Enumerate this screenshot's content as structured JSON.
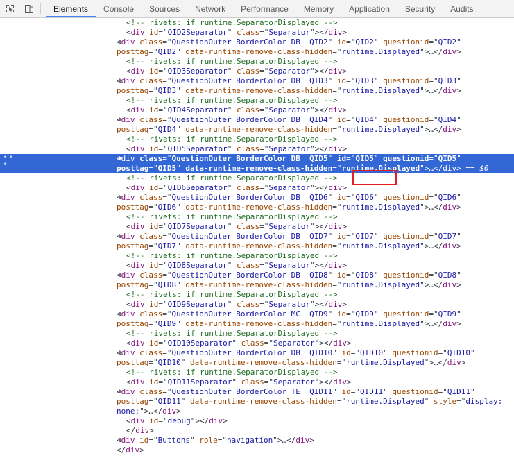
{
  "toolbar": {
    "icons": [
      {
        "name": "inspect-element-icon",
        "title": "Inspect element"
      },
      {
        "name": "device-toolbar-icon",
        "title": "Toggle device toolbar"
      }
    ],
    "tabs": [
      {
        "label": "Elements",
        "selected": true
      },
      {
        "label": "Console",
        "selected": false
      },
      {
        "label": "Sources",
        "selected": false
      },
      {
        "label": "Network",
        "selected": false
      },
      {
        "label": "Performance",
        "selected": false
      },
      {
        "label": "Memory",
        "selected": false
      },
      {
        "label": "Application",
        "selected": false
      },
      {
        "label": "Security",
        "selected": false
      },
      {
        "label": "Audits",
        "selected": false
      }
    ],
    "accent_color": "#4285f4"
  },
  "dom_tree": {
    "selection_highlight_color": "#3367d6",
    "annotation_box_color": "#e02020",
    "annotated_text": "id=\"QID5\"",
    "selected_suffix": "== $0",
    "row_ellipsis_label": "•••",
    "rows": [
      {
        "type": "comment",
        "indent": 2,
        "text": "<!-- rivets: if runtime.SeparatorDisplayed -->"
      },
      {
        "type": "element",
        "indent": 2,
        "tag": "div",
        "attrs": [
          [
            "id",
            "QID2Separator"
          ],
          [
            "class",
            "Separator"
          ]
        ],
        "close": "</div>"
      },
      {
        "type": "question",
        "indent": 1,
        "tag": "div",
        "twisty": true,
        "selected": false,
        "attrs": [
          [
            "class",
            "QuestionOuter BorderColor DB  QID2"
          ],
          [
            "id",
            "QID2"
          ],
          [
            "questionid",
            "QID2"
          ],
          [
            "posttag",
            "QID2"
          ],
          [
            "data-runtime-remove-class-hidden",
            "runtime.Displayed"
          ]
        ],
        "ellipsis": true,
        "close": "</div>"
      },
      {
        "type": "comment",
        "indent": 2,
        "text": "<!-- rivets: if runtime.SeparatorDisplayed -->"
      },
      {
        "type": "element",
        "indent": 2,
        "tag": "div",
        "attrs": [
          [
            "id",
            "QID3Separator"
          ],
          [
            "class",
            "Separator"
          ]
        ],
        "close": "</div>"
      },
      {
        "type": "question",
        "indent": 1,
        "tag": "div",
        "twisty": true,
        "selected": false,
        "attrs": [
          [
            "class",
            "QuestionOuter BorderColor DB  QID3"
          ],
          [
            "id",
            "QID3"
          ],
          [
            "questionid",
            "QID3"
          ],
          [
            "posttag",
            "QID3"
          ],
          [
            "data-runtime-remove-class-hidden",
            "runtime.Displayed"
          ]
        ],
        "ellipsis": true,
        "close": "</div>"
      },
      {
        "type": "comment",
        "indent": 2,
        "text": "<!-- rivets: if runtime.SeparatorDisplayed -->"
      },
      {
        "type": "element",
        "indent": 2,
        "tag": "div",
        "attrs": [
          [
            "id",
            "QID4Separator"
          ],
          [
            "class",
            "Separator"
          ]
        ],
        "close": "</div>"
      },
      {
        "type": "question",
        "indent": 1,
        "tag": "div",
        "twisty": true,
        "selected": false,
        "attrs": [
          [
            "class",
            "QuestionOuter BorderColor DB  QID4"
          ],
          [
            "id",
            "QID4"
          ],
          [
            "questionid",
            "QID4"
          ],
          [
            "posttag",
            "QID4"
          ],
          [
            "data-runtime-remove-class-hidden",
            "runtime.Displayed"
          ]
        ],
        "ellipsis": true,
        "close": "</div>"
      },
      {
        "type": "comment",
        "indent": 2,
        "text": "<!-- rivets: if runtime.SeparatorDisplayed -->"
      },
      {
        "type": "element",
        "indent": 2,
        "tag": "div",
        "attrs": [
          [
            "id",
            "QID5Separator"
          ],
          [
            "class",
            "Separator"
          ]
        ],
        "close": "</div>"
      },
      {
        "type": "question",
        "indent": 1,
        "tag": "div",
        "twisty": true,
        "selected": true,
        "attrs": [
          [
            "class",
            "QuestionOuter BorderColor DB  QID5"
          ],
          [
            "id",
            "QID5"
          ],
          [
            "questionid",
            "QID5"
          ],
          [
            "posttag",
            "QID5"
          ],
          [
            "data-runtime-remove-class-hidden",
            "runtime.Displayed"
          ]
        ],
        "ellipsis": true,
        "close": "</div>",
        "suffix": "== $0"
      },
      {
        "type": "comment",
        "indent": 2,
        "text": "<!-- rivets: if runtime.SeparatorDisplayed -->"
      },
      {
        "type": "element",
        "indent": 2,
        "tag": "div",
        "attrs": [
          [
            "id",
            "QID6Separator"
          ],
          [
            "class",
            "Separator"
          ]
        ],
        "close": "</div>"
      },
      {
        "type": "question",
        "indent": 1,
        "tag": "div",
        "twisty": true,
        "selected": false,
        "attrs": [
          [
            "class",
            "QuestionOuter BorderColor DB  QID6"
          ],
          [
            "id",
            "QID6"
          ],
          [
            "questionid",
            "QID6"
          ],
          [
            "posttag",
            "QID6"
          ],
          [
            "data-runtime-remove-class-hidden",
            "runtime.Displayed"
          ]
        ],
        "ellipsis": true,
        "close": "</div>"
      },
      {
        "type": "comment",
        "indent": 2,
        "text": "<!-- rivets: if runtime.SeparatorDisplayed -->"
      },
      {
        "type": "element",
        "indent": 2,
        "tag": "div",
        "attrs": [
          [
            "id",
            "QID7Separator"
          ],
          [
            "class",
            "Separator"
          ]
        ],
        "close": "</div>"
      },
      {
        "type": "question",
        "indent": 1,
        "tag": "div",
        "twisty": true,
        "selected": false,
        "attrs": [
          [
            "class",
            "QuestionOuter BorderColor DB  QID7"
          ],
          [
            "id",
            "QID7"
          ],
          [
            "questionid",
            "QID7"
          ],
          [
            "posttag",
            "QID7"
          ],
          [
            "data-runtime-remove-class-hidden",
            "runtime.Displayed"
          ]
        ],
        "ellipsis": true,
        "close": "</div>"
      },
      {
        "type": "comment",
        "indent": 2,
        "text": "<!-- rivets: if runtime.SeparatorDisplayed -->"
      },
      {
        "type": "element",
        "indent": 2,
        "tag": "div",
        "attrs": [
          [
            "id",
            "QID8Separator"
          ],
          [
            "class",
            "Separator"
          ]
        ],
        "close": "</div>"
      },
      {
        "type": "question",
        "indent": 1,
        "tag": "div",
        "twisty": true,
        "selected": false,
        "attrs": [
          [
            "class",
            "QuestionOuter BorderColor DB  QID8"
          ],
          [
            "id",
            "QID8"
          ],
          [
            "questionid",
            "QID8"
          ],
          [
            "posttag",
            "QID8"
          ],
          [
            "data-runtime-remove-class-hidden",
            "runtime.Displayed"
          ]
        ],
        "ellipsis": true,
        "close": "</div>"
      },
      {
        "type": "comment",
        "indent": 2,
        "text": "<!-- rivets: if runtime.SeparatorDisplayed -->"
      },
      {
        "type": "element",
        "indent": 2,
        "tag": "div",
        "attrs": [
          [
            "id",
            "QID9Separator"
          ],
          [
            "class",
            "Separator"
          ]
        ],
        "close": "</div>"
      },
      {
        "type": "question",
        "indent": 1,
        "tag": "div",
        "twisty": true,
        "selected": false,
        "attrs": [
          [
            "class",
            "QuestionOuter BorderColor MC  QID9"
          ],
          [
            "id",
            "QID9"
          ],
          [
            "questionid",
            "QID9"
          ],
          [
            "posttag",
            "QID9"
          ],
          [
            "data-runtime-remove-class-hidden",
            "runtime.Displayed"
          ]
        ],
        "ellipsis": true,
        "close": "</div>"
      },
      {
        "type": "comment",
        "indent": 2,
        "text": "<!-- rivets: if runtime.SeparatorDisplayed -->"
      },
      {
        "type": "element",
        "indent": 2,
        "tag": "div",
        "attrs": [
          [
            "id",
            "QID10Separator"
          ],
          [
            "class",
            "Separator"
          ]
        ],
        "close": "</div>"
      },
      {
        "type": "question",
        "indent": 1,
        "tag": "div",
        "twisty": true,
        "selected": false,
        "attrs": [
          [
            "class",
            "QuestionOuter BorderColor DB  QID10"
          ],
          [
            "id",
            "QID10"
          ],
          [
            "questionid",
            "QID10"
          ],
          [
            "posttag",
            "QID10"
          ],
          [
            "data-runtime-remove-class-hidden",
            "runtime.Displayed"
          ]
        ],
        "ellipsis": true,
        "close": "</div>"
      },
      {
        "type": "comment",
        "indent": 2,
        "text": "<!-- rivets: if runtime.SeparatorDisplayed -->"
      },
      {
        "type": "element",
        "indent": 2,
        "tag": "div",
        "attrs": [
          [
            "id",
            "QID11Separator"
          ],
          [
            "class",
            "Separator"
          ]
        ],
        "close": "</div>"
      },
      {
        "type": "question",
        "indent": 1,
        "tag": "div",
        "twisty": true,
        "selected": false,
        "attrs": [
          [
            "class",
            "QuestionOuter BorderColor TE  QID11"
          ],
          [
            "id",
            "QID11"
          ],
          [
            "questionid",
            "QID11"
          ],
          [
            "posttag",
            "QID11"
          ],
          [
            "data-runtime-remove-class-hidden",
            "runtime.Displayed"
          ],
          [
            "style",
            "display: none;"
          ]
        ],
        "ellipsis": true,
        "close": "</div>"
      },
      {
        "type": "element",
        "indent": 3,
        "tag": "div",
        "attrs": [
          [
            "id",
            "debug"
          ]
        ],
        "close": "</div>"
      },
      {
        "type": "closetag",
        "indent": 2,
        "text": "</div>"
      },
      {
        "type": "question",
        "indent": 1,
        "tag": "div",
        "twisty": true,
        "selected": false,
        "attrs": [
          [
            "id",
            "Buttons"
          ],
          [
            "role",
            "navigation"
          ]
        ],
        "ellipsis": true,
        "close": "</div>"
      },
      {
        "type": "closetag",
        "indent": 1,
        "text": "</div>"
      }
    ]
  }
}
